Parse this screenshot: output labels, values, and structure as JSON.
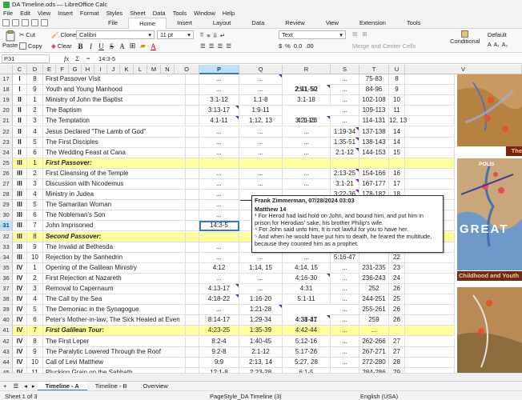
{
  "window": {
    "title": "DA Timeline.ods — LibreOffice Calc"
  },
  "menu": [
    "File",
    "Edit",
    "View",
    "Insert",
    "Format",
    "Styles",
    "Sheet",
    "Data",
    "Tools",
    "Window",
    "Help"
  ],
  "ribbon_tabs": [
    "File",
    "Home",
    "Insert",
    "Layout",
    "Data",
    "Review",
    "View",
    "Extension",
    "Tools"
  ],
  "ribbon": {
    "paste": "Paste",
    "cut": "Cut",
    "copy": "Copy",
    "clone": "Clone",
    "clear": "Clear",
    "font_name": "Calibri",
    "font_size": "11 pt",
    "number_format": "Text",
    "merge": "Merge and Center Cells",
    "conditional": "Conditional",
    "style": "Default"
  },
  "formula_bar": {
    "cell_ref": "P31",
    "content": "14:3-5"
  },
  "columns": [
    "C",
    "D",
    "E",
    "F",
    "G",
    "H",
    "I",
    "J",
    "K",
    "L",
    "M",
    "N",
    "O",
    "P",
    "Q",
    "R",
    "S",
    "T",
    "U",
    "V"
  ],
  "selected_column": "P",
  "rows": [
    {
      "n": "17",
      "c": "I",
      "d": "8",
      "e": "First Passover Visit",
      "p": "...",
      "q": "...",
      "r": "2:41-50",
      "s": "...",
      "t": "75-83",
      "u": "8",
      "y": false,
      "m": [
        1,
        2
      ]
    },
    {
      "n": "18",
      "c": "I",
      "d": "9",
      "e": "Youth and Young Manhood",
      "p": "...",
      "q": "...",
      "r": "2:51, 52",
      "s": "...",
      "t": "84-96",
      "u": "9",
      "y": false,
      "m": [
        2
      ]
    },
    {
      "n": "19",
      "c": "II",
      "d": "1",
      "e": "Ministry of John the Baptist",
      "p": "3:1-12",
      "q": "1:1-8",
      "r": "3:1-18",
      "s": "...",
      "t": "102-108",
      "u": "10",
      "y": false,
      "m": []
    },
    {
      "n": "20",
      "c": "II",
      "d": "2",
      "e": "The Baptism",
      "p": "3:13-17",
      "q": "1:9-11",
      "r": "3:21-23",
      "s": "...",
      "t": "109-113",
      "u": "11",
      "y": false,
      "m": [
        0,
        2
      ]
    },
    {
      "n": "21",
      "c": "II",
      "d": "3",
      "e": "The Temptation",
      "p": "4:1-11",
      "q": "1:12, 13",
      "r": "4:1-13",
      "s": "...",
      "t": "114-131",
      "u": "12, 13",
      "y": false,
      "m": [
        0
      ]
    },
    {
      "n": "22",
      "c": "II",
      "d": "4",
      "e": "Jesus Declared \"The Lamb of God\"",
      "p": "...",
      "q": "...",
      "r": "...",
      "s": "1:19-34",
      "t": "137-138",
      "u": "14",
      "y": false,
      "m": [
        3
      ]
    },
    {
      "n": "23",
      "c": "II",
      "d": "5",
      "e": "The First Disciples",
      "p": "...",
      "q": "...",
      "r": "...",
      "s": "1:35-51",
      "t": "138-143",
      "u": "14",
      "y": false,
      "m": [
        3
      ]
    },
    {
      "n": "24",
      "c": "II",
      "d": "6",
      "e": "The Wedding Feast at Cana",
      "p": "...",
      "q": "...",
      "r": "...",
      "s": "2:1-12",
      "t": "144-153",
      "u": "15",
      "y": false,
      "m": [
        3
      ]
    },
    {
      "n": "25",
      "c": "III",
      "d": "1",
      "e": "First Passover:",
      "p": "",
      "q": "",
      "r": "",
      "s": "",
      "t": "",
      "u": "",
      "y": true,
      "m": []
    },
    {
      "n": "26",
      "c": "III",
      "d": "2",
      "e": "First Cleansing of the Temple",
      "p": "...",
      "q": "...",
      "r": "...",
      "s": "2:13-25",
      "t": "154-166",
      "u": "16",
      "y": false,
      "m": [
        3
      ]
    },
    {
      "n": "27",
      "c": "III",
      "d": "3",
      "e": "Discussion with Nicodemus",
      "p": "...",
      "q": "...",
      "r": "...",
      "s": "3:1-21",
      "t": "167-177",
      "u": "17",
      "y": false,
      "m": [
        3
      ]
    },
    {
      "n": "28",
      "c": "III",
      "d": "4",
      "e": "Ministry in Judea",
      "p": "...",
      "q": "...",
      "r": "...",
      "s": "3:22-36",
      "t": "178-182",
      "u": "18",
      "y": false,
      "m": [
        3
      ]
    },
    {
      "n": "29",
      "c": "III",
      "d": "5",
      "e": "The Samaritan Woman",
      "p": "...",
      "q": "...",
      "r": "...",
      "s": "",
      "t": "",
      "u": "",
      "y": false,
      "m": []
    },
    {
      "n": "30",
      "c": "III",
      "d": "6",
      "e": "The Nobleman's Son",
      "p": "...",
      "q": "...",
      "r": "...",
      "s": "",
      "t": "",
      "u": "",
      "y": false,
      "m": []
    },
    {
      "n": "31",
      "c": "III",
      "d": "7",
      "e": "John Imprisoned",
      "p": "14:3-5",
      "q": "",
      "r": "",
      "s": "",
      "t": "",
      "u": "",
      "y": false,
      "m": [],
      "cursor": true
    },
    {
      "n": "32",
      "c": "III",
      "d": "8",
      "e": "Second Passover:",
      "p": "",
      "q": "",
      "r": "",
      "s": "",
      "t": "",
      "u": "",
      "y": true,
      "m": []
    },
    {
      "n": "33",
      "c": "III",
      "d": "9",
      "e": "The Invalid at Bethesda",
      "p": "...",
      "q": "...",
      "r": "...",
      "s": "",
      "t": "",
      "u": "",
      "y": false,
      "m": []
    },
    {
      "n": "34",
      "c": "III",
      "d": "10",
      "e": "Rejection by the Sanhedrin",
      "p": "...",
      "q": "...",
      "r": "...",
      "s": "5:16-47",
      "t": "",
      "u": "22",
      "y": false,
      "m": []
    },
    {
      "n": "35",
      "c": "IV",
      "d": "1",
      "e": "Opening of the Galilean Ministry",
      "p": "4:12",
      "q": "1:14, 15",
      "r": "4:14, 15",
      "s": "...",
      "t": "231-235",
      "u": "23",
      "y": false,
      "m": []
    },
    {
      "n": "36",
      "c": "IV",
      "d": "2",
      "e": "First Rejection at Nazareth",
      "p": "...",
      "q": "...",
      "r": "4:16-30",
      "s": "...",
      "t": "236-243",
      "u": "24",
      "y": false,
      "m": [
        2
      ]
    },
    {
      "n": "37",
      "c": "IV",
      "d": "3",
      "e": "Removal to Capernaum",
      "p": "4:13-17",
      "q": "...",
      "r": "4:31",
      "s": "...",
      "t": "252",
      "u": "26",
      "y": false,
      "m": [
        0
      ]
    },
    {
      "n": "38",
      "c": "IV",
      "d": "4",
      "e": "The Call by the Sea",
      "p": "4:18-22",
      "q": "1:16-20",
      "r": "5:1-11",
      "s": "...",
      "t": "244-251",
      "u": "25",
      "y": false,
      "m": [
        0
      ]
    },
    {
      "n": "39",
      "c": "IV",
      "d": "5",
      "e": "The Demoniac in the Synagogue",
      "p": "...",
      "q": "1:21-28",
      "r": "4:31-37",
      "s": "...",
      "t": "255-261",
      "u": "26",
      "y": false,
      "m": [
        1,
        2
      ]
    },
    {
      "n": "40",
      "c": "IV",
      "d": "6",
      "e": "Peter's Mother-in-law; The Sick Healed at Even",
      "p": "8:14-17",
      "q": "1:29-34",
      "r": "4:38-41",
      "s": "...",
      "t": "259",
      "u": "26",
      "y": false,
      "m": []
    },
    {
      "n": "41",
      "c": "IV",
      "d": "7",
      "e": "First Galilean Tour:",
      "p": "4:23-25",
      "q": "1:35-39",
      "r": "4:42-44",
      "s": "...",
      "t": "...",
      "u": "",
      "y": true,
      "m": []
    },
    {
      "n": "42",
      "c": "IV",
      "d": "8",
      "e": "The First Leper",
      "p": "8:2-4",
      "q": "1:40-45",
      "r": "5:12-16",
      "s": "...",
      "t": "262-266",
      "u": "27",
      "y": false,
      "m": []
    },
    {
      "n": "43",
      "c": "IV",
      "d": "9",
      "e": "The Paralytic Lowered Through the Roof",
      "p": "9:2-8",
      "q": "2:1-12",
      "r": "5:17-26",
      "s": "...",
      "t": "267-271",
      "u": "27",
      "y": false,
      "m": []
    },
    {
      "n": "44",
      "c": "IV",
      "d": "10",
      "e": "Call of Levi Matthew",
      "p": "9:9",
      "q": "2:13, 14",
      "r": "5:27, 28",
      "s": "...",
      "t": "272-280",
      "u": "28",
      "y": false,
      "m": []
    },
    {
      "n": "45",
      "c": "IV",
      "d": "11",
      "e": "Plucking Grain on the Sabbath",
      "p": "12:1-8",
      "q": "2:23-28",
      "r": "6:1-5",
      "s": "...",
      "t": "284-286",
      "u": "29",
      "y": false,
      "m": []
    }
  ],
  "comment": {
    "author": "Frank Zimmerman, 07/28/2024 03:03",
    "chapter": "Matthew 14",
    "text": [
      "³ For Herod had laid hold on John, and bound him, and put him in prison for Herodias' sake, his brother Philip's wife.",
      "⁴ For John said unto him, It is not lawful for you to have her.",
      "⁵ And when he would have put him to death, he feared the multitude, because they counted him as a prophet."
    ]
  },
  "images": {
    "map1_caption": "The",
    "map2_label": "GREAT",
    "map2_caption": "Childhood and Youth",
    "map2_places": "POLIS"
  },
  "sheet_tabs": [
    "Timeline - A",
    "Timeline - B",
    "Overview"
  ],
  "active_sheet": "Timeline - A",
  "status": {
    "sheet": "Sheet 1 of 3",
    "page_style": "PageStyle_DA Timeline (3)",
    "language": "English (USA)"
  },
  "colors": {
    "accent": "#2f7fc1",
    "highlight_row": "#ffff9e",
    "comment_marker": "#6b2a8a"
  }
}
